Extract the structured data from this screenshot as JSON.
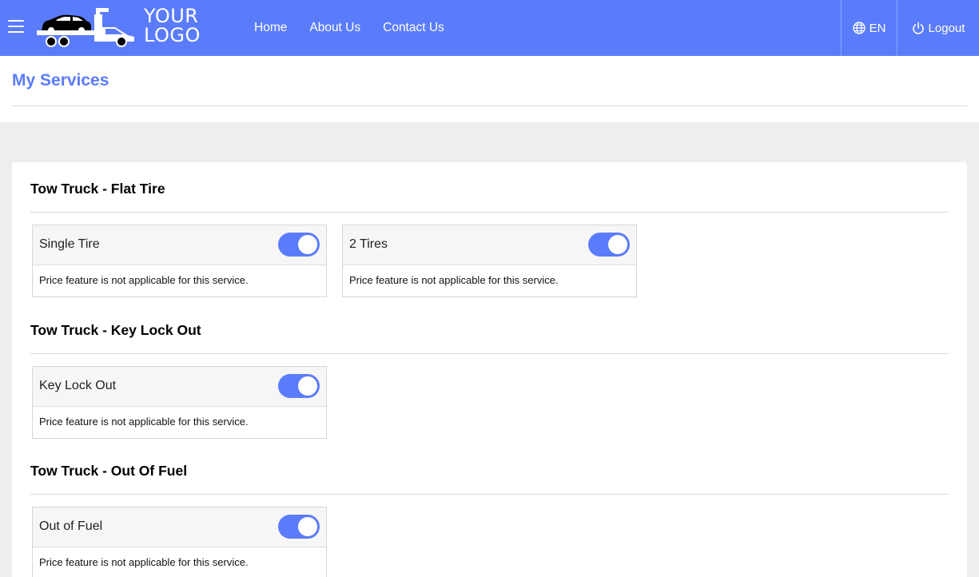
{
  "navbar": {
    "logo_line1": "YOUR",
    "logo_line2": "LOGO",
    "links": [
      "Home",
      "About Us",
      "Contact Us"
    ],
    "language": "EN",
    "logout": "Logout"
  },
  "page": {
    "title": "My Services"
  },
  "sections": [
    {
      "title": "Tow Truck - Flat Tire",
      "services": [
        {
          "name": "Single Tire",
          "enabled": true,
          "note": "Price feature is not applicable for this service."
        },
        {
          "name": "2 Tires",
          "enabled": true,
          "note": "Price feature is not applicable for this service."
        }
      ]
    },
    {
      "title": "Tow Truck - Key Lock Out",
      "services": [
        {
          "name": "Key Lock Out",
          "enabled": true,
          "note": "Price feature is not applicable for this service."
        }
      ]
    },
    {
      "title": "Tow Truck - Out Of Fuel",
      "services": [
        {
          "name": "Out of Fuel",
          "enabled": true,
          "note": "Price feature is not applicable for this service."
        }
      ]
    }
  ],
  "colors": {
    "accent": "#5b7cfa",
    "background": "#eeeeee"
  }
}
